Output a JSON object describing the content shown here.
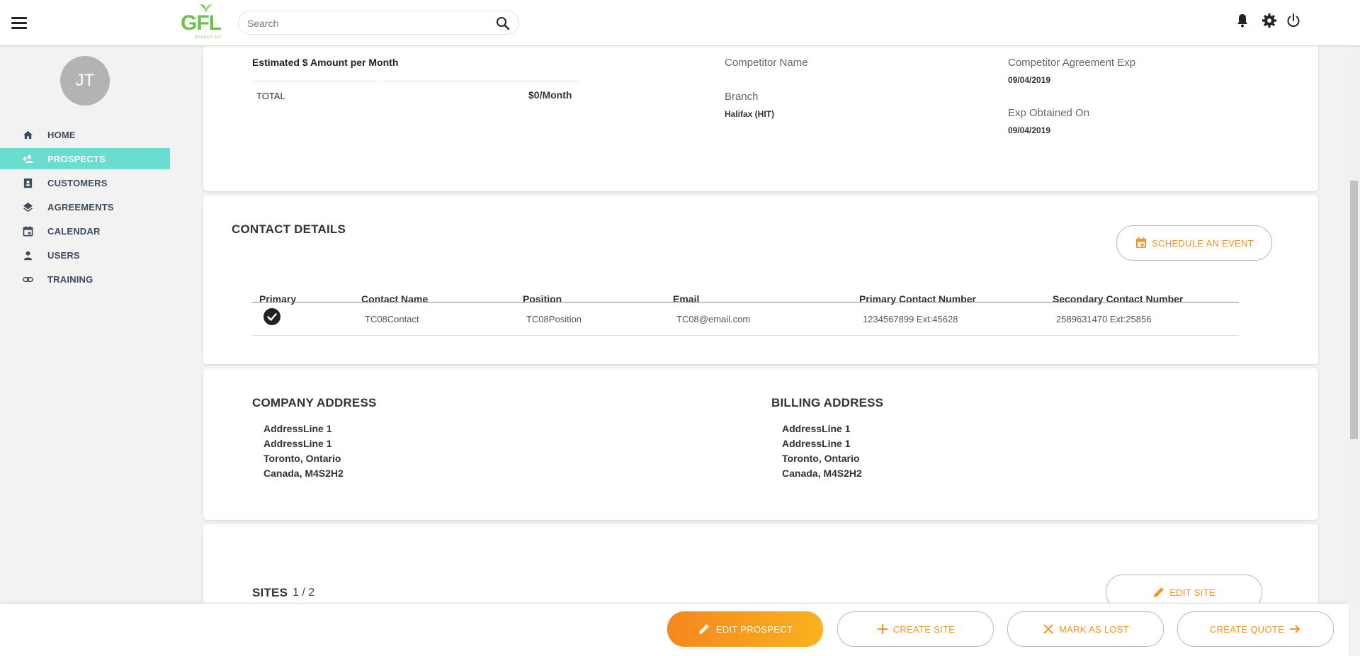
{
  "search": {
    "placeholder": "Search"
  },
  "logo": {
    "text": "GFL",
    "sub": "STREET FIT"
  },
  "user": {
    "initials": "JT"
  },
  "nav": [
    {
      "label": "HOME",
      "icon": "home-icon"
    },
    {
      "label": "PROSPECTS",
      "icon": "add-person-icon",
      "active": true
    },
    {
      "label": "CUSTOMERS",
      "icon": "contact-card-icon"
    },
    {
      "label": "AGREEMENTS",
      "icon": "layers-icon"
    },
    {
      "label": "CALENDAR",
      "icon": "calendar-icon"
    },
    {
      "label": "USERS",
      "icon": "person-icon"
    },
    {
      "label": "TRAINING",
      "icon": "link-icon"
    }
  ],
  "estimate": {
    "title": "Estimated $ Amount per Month",
    "total_label": "TOTAL",
    "total_value": "$0/Month"
  },
  "competitor": {
    "name_label": "Competitor Name",
    "name_value": "",
    "branch_label": "Branch",
    "branch_value": "Halifax (HIT)",
    "agreement_exp_label": "Competitor Agreement Exp",
    "agreement_exp_value": "09/04/2019",
    "exp_obtained_label": "Exp Obtained On",
    "exp_obtained_value": "09/04/2019"
  },
  "contact_details": {
    "title": "CONTACT DETAILS",
    "schedule_label": "SCHEDULE AN EVENT",
    "columns": [
      "Primary",
      "Contact Name",
      "Position",
      "Email",
      "Primary Contact Number",
      "Secondary Contact Number"
    ],
    "rows": [
      {
        "primary": true,
        "name": "TC08Contact",
        "position": "TC08Position",
        "email": "TC08@email.com",
        "primary_number": "1234567899 Ext:45628",
        "secondary_number": "2589631470 Ext:25856"
      }
    ]
  },
  "company_address": {
    "title": "COMPANY ADDRESS",
    "lines": [
      "AddressLine 1",
      "AddressLine 1",
      "Toronto, Ontario",
      "Canada, M4S2H2"
    ]
  },
  "billing_address": {
    "title": "BILLING ADDRESS",
    "lines": [
      "AddressLine 1",
      "AddressLine 1",
      "Toronto, Ontario",
      "Canada, M4S2H2"
    ]
  },
  "sites": {
    "title": "SITES",
    "count": "1 / 2",
    "edit_label": "EDIT SITE"
  },
  "actions": {
    "edit_prospect": "EDIT PROSPECT",
    "create_site": "CREATE SITE",
    "mark_as_lost": "MARK AS LOST",
    "create_quote": "CREATE QUOTE"
  },
  "colors": {
    "accent_orange": "#f7931e",
    "active_nav": "#6adcd0",
    "logo_green": "#6cc24a"
  }
}
